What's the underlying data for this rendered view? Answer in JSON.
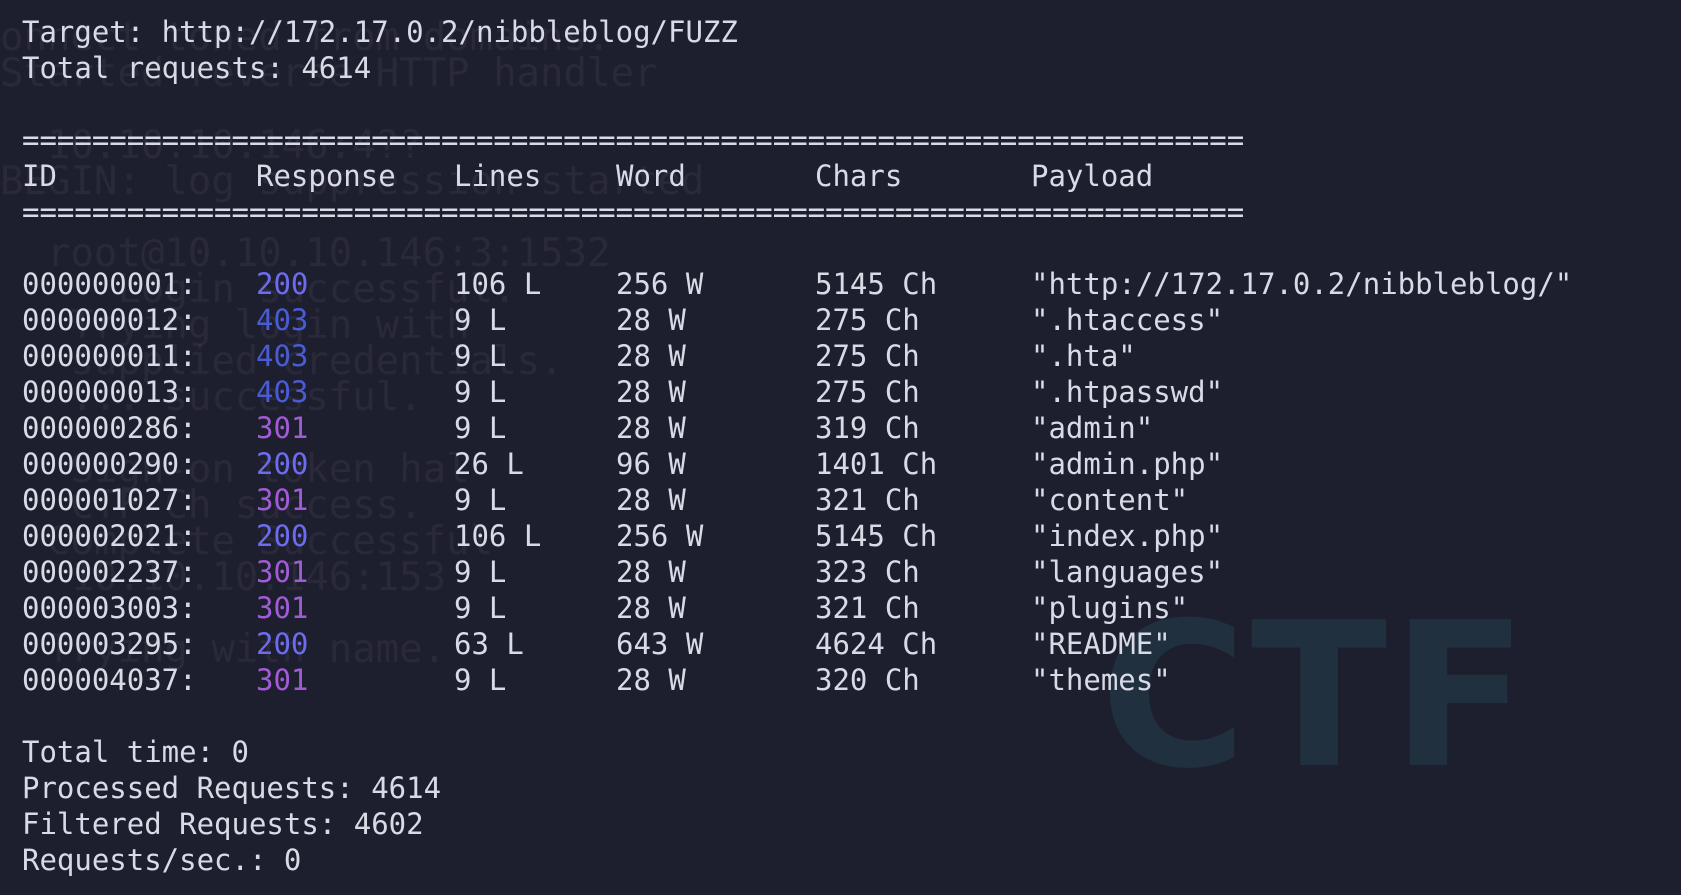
{
  "background": {
    "ghost_lines": [
      "onnect toned from domains.",
      "Started reverse HTTP handler",
      "",
      "  10.10.10.146:4??",
      "BEGIN: log suppression started",
      "",
      "  root@10.10.10.146:3:1532",
      "     Login successful.",
      "   Trying login with",
      "   supplied credentials.",
      "   ... successful.",
      "",
      "   Sign-on token hal",
      "   CTF Ch success.",
      "  Complete Successful",
      "   10.10.10.146:153",
      "",
      "  Trying with name."
    ],
    "watermark": "CTF"
  },
  "header": {
    "target_line": "Target: http://172.17.0.2/nibbleblog/FUZZ",
    "total_requests_line": "Total requests: 4614"
  },
  "table": {
    "rule": "======================================================================",
    "columns": [
      "ID",
      "Response",
      "Lines",
      "Word",
      "Chars",
      "Payload"
    ],
    "status_colors": {
      "200": "#6d6cf0",
      "403": "#4a5bd6",
      "301": "#a25bd6"
    },
    "rows": [
      {
        "id": "000000001:",
        "response": "200",
        "lines": "106 L",
        "word": "256 W",
        "chars": "5145 Ch",
        "payload": "\"http://172.17.0.2/nibbleblog/\""
      },
      {
        "id": "000000012:",
        "response": "403",
        "lines": "9 L",
        "word": "28 W",
        "chars": "275 Ch",
        "payload": "\".htaccess\""
      },
      {
        "id": "000000011:",
        "response": "403",
        "lines": "9 L",
        "word": "28 W",
        "chars": "275 Ch",
        "payload": "\".hta\""
      },
      {
        "id": "000000013:",
        "response": "403",
        "lines": "9 L",
        "word": "28 W",
        "chars": "275 Ch",
        "payload": "\".htpasswd\""
      },
      {
        "id": "000000286:",
        "response": "301",
        "lines": "9 L",
        "word": "28 W",
        "chars": "319 Ch",
        "payload": "\"admin\""
      },
      {
        "id": "000000290:",
        "response": "200",
        "lines": "26 L",
        "word": "96 W",
        "chars": "1401 Ch",
        "payload": "\"admin.php\""
      },
      {
        "id": "000001027:",
        "response": "301",
        "lines": "9 L",
        "word": "28 W",
        "chars": "321 Ch",
        "payload": "\"content\""
      },
      {
        "id": "000002021:",
        "response": "200",
        "lines": "106 L",
        "word": "256 W",
        "chars": "5145 Ch",
        "payload": "\"index.php\""
      },
      {
        "id": "000002237:",
        "response": "301",
        "lines": "9 L",
        "word": "28 W",
        "chars": "323 Ch",
        "payload": "\"languages\""
      },
      {
        "id": "000003003:",
        "response": "301",
        "lines": "9 L",
        "word": "28 W",
        "chars": "321 Ch",
        "payload": "\"plugins\""
      },
      {
        "id": "000003295:",
        "response": "200",
        "lines": "63 L",
        "word": "643 W",
        "chars": "4624 Ch",
        "payload": "\"README\""
      },
      {
        "id": "000004037:",
        "response": "301",
        "lines": "9 L",
        "word": "28 W",
        "chars": "320 Ch",
        "payload": "\"themes\""
      }
    ]
  },
  "footer": {
    "total_time": "Total time: 0",
    "processed": "Processed Requests: 4614",
    "filtered": "Filtered Requests: 4602",
    "rate": "Requests/sec.: 0"
  }
}
